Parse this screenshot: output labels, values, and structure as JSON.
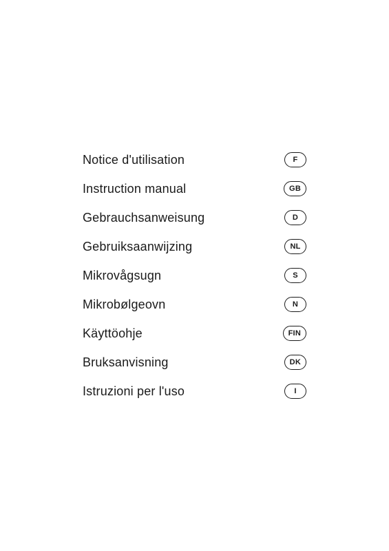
{
  "items": [
    {
      "label": "Notice d'utilisation",
      "badge": "F"
    },
    {
      "label": "Instruction manual",
      "badge": "GB"
    },
    {
      "label": "Gebrauchsanweisung",
      "badge": "D"
    },
    {
      "label": "Gebruiksaanwijzing",
      "badge": "NL"
    },
    {
      "label": "Mikrovågsugn",
      "badge": "S"
    },
    {
      "label": "Mikrobølgeovn",
      "badge": "N"
    },
    {
      "label": "Käyttöohje",
      "badge": "FIN"
    },
    {
      "label": "Bruksanvisning",
      "badge": "DK"
    },
    {
      "label": "Istruzioni per l'uso",
      "badge": "I"
    }
  ]
}
